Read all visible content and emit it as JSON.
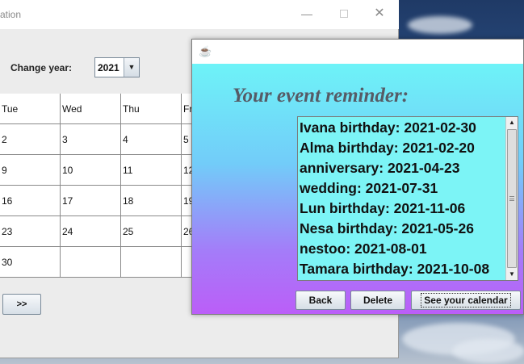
{
  "calendar_window": {
    "title_fragment": "ation",
    "controls": {
      "minimize": "—",
      "maximize": "",
      "close": "✕"
    },
    "year_label": "Change year:",
    "year_value": "2021",
    "day_headers": [
      "Tue",
      "Wed",
      "Thu",
      "Fr"
    ],
    "rows": [
      [
        "2",
        "3",
        "4",
        "5"
      ],
      [
        "9",
        "10",
        "11",
        "12"
      ],
      [
        "16",
        "17",
        "18",
        "19"
      ],
      [
        "23",
        "24",
        "25",
        "26"
      ],
      [
        "30",
        "",
        "",
        ""
      ]
    ],
    "next_button": ">>"
  },
  "dialog": {
    "heading": "Your event reminder:",
    "events": [
      "Ivana birthday: 2021-02-30",
      "Alma birthday: 2021-02-20",
      "anniversary: 2021-04-23",
      "wedding: 2021-07-31",
      "Lun birthday: 2021-11-06",
      "Nesa birthday: 2021-05-26",
      "nestoo: 2021-08-01",
      "Tamara birthday: 2021-10-08"
    ],
    "buttons": {
      "back": "Back",
      "delete": "Delete",
      "see_calendar": "See your calendar"
    },
    "colors": {
      "gradient_top": "#6ef3f8",
      "gradient_bottom": "#bb5ef8",
      "list_bg": "#7cf4f6"
    }
  }
}
